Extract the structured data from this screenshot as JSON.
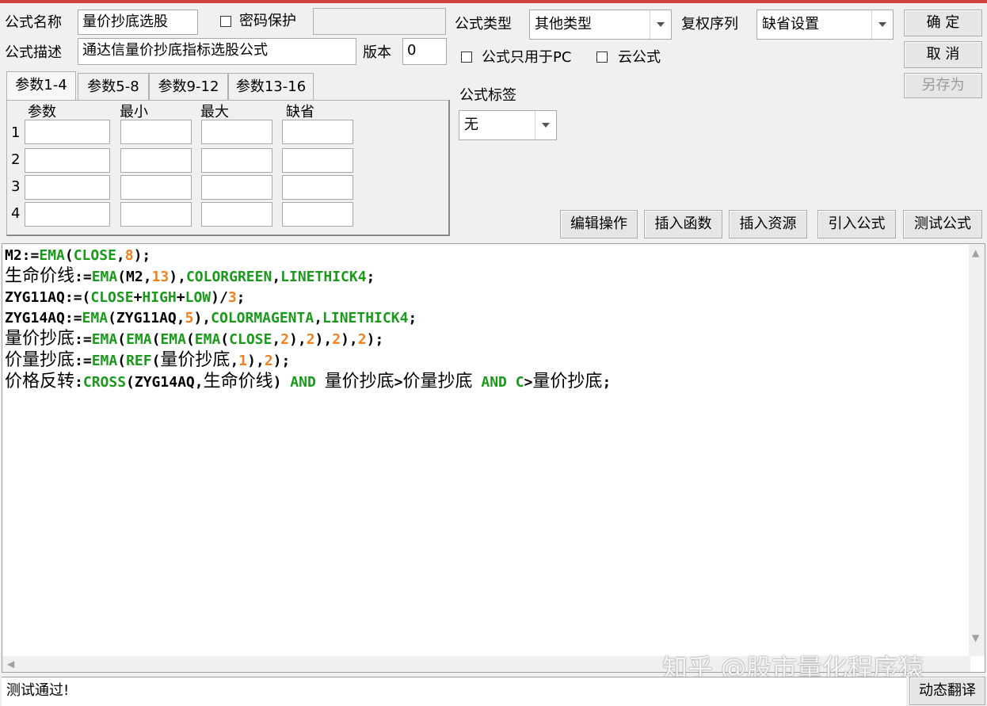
{
  "header": {
    "name_label": "公式名称",
    "name_value": "量价抄底选股",
    "password_label": "密码保护",
    "desc_label": "公式描述",
    "desc_value": "通达信量价抄底指标选股公式",
    "version_label": "版本",
    "version_value": "0",
    "type_label": "公式类型",
    "type_value": "其他类型",
    "rights_label": "复权序列",
    "rights_value": "缺省设置",
    "pc_only_label": "公式只用于PC",
    "cloud_label": "云公式",
    "tag_label": "公式标签",
    "tag_value": "无"
  },
  "buttons": {
    "ok": "确 定",
    "cancel": "取 消",
    "save_as": "另存为",
    "edit_ops": "编辑操作",
    "insert_func": "插入函数",
    "insert_res": "插入资源",
    "import_formula": "引入公式",
    "test_formula": "测试公式",
    "dynamic_translate": "动态翻译"
  },
  "params": {
    "tabs": [
      "参数1-4",
      "参数5-8",
      "参数9-12",
      "参数13-16"
    ],
    "columns": [
      "参数",
      "最小",
      "最大",
      "缺省"
    ],
    "rows": [
      "1",
      "2",
      "3",
      "4"
    ]
  },
  "code_lines": [
    [
      {
        "t": "M2:=",
        "c": "k"
      },
      {
        "t": "EMA",
        "c": "g"
      },
      {
        "t": "(",
        "c": "k"
      },
      {
        "t": "CLOSE",
        "c": "g"
      },
      {
        "t": ",",
        "c": "k"
      },
      {
        "t": "8",
        "c": "o"
      },
      {
        "t": ");",
        "c": "k"
      }
    ],
    [
      {
        "t": "生命价线",
        "c": "cn"
      },
      {
        "t": ":=",
        "c": "k"
      },
      {
        "t": "EMA",
        "c": "g"
      },
      {
        "t": "(M2,",
        "c": "k"
      },
      {
        "t": "13",
        "c": "o"
      },
      {
        "t": "),",
        "c": "k"
      },
      {
        "t": "COLORGREEN",
        "c": "g"
      },
      {
        "t": ",",
        "c": "k"
      },
      {
        "t": "LINETHICK4",
        "c": "g"
      },
      {
        "t": ";",
        "c": "k"
      }
    ],
    [
      {
        "t": "ZYG11AQ:=(",
        "c": "k"
      },
      {
        "t": "CLOSE",
        "c": "g"
      },
      {
        "t": "+",
        "c": "k"
      },
      {
        "t": "HIGH",
        "c": "g"
      },
      {
        "t": "+",
        "c": "k"
      },
      {
        "t": "LOW",
        "c": "g"
      },
      {
        "t": ")/",
        "c": "k"
      },
      {
        "t": "3",
        "c": "o"
      },
      {
        "t": ";",
        "c": "k"
      }
    ],
    [
      {
        "t": "ZYG14AQ:=",
        "c": "k"
      },
      {
        "t": "EMA",
        "c": "g"
      },
      {
        "t": "(ZYG11AQ,",
        "c": "k"
      },
      {
        "t": "5",
        "c": "o"
      },
      {
        "t": "),",
        "c": "k"
      },
      {
        "t": "COLORMAGENTA",
        "c": "g"
      },
      {
        "t": ",",
        "c": "k"
      },
      {
        "t": "LINETHICK4",
        "c": "g"
      },
      {
        "t": ";",
        "c": "k"
      }
    ],
    [
      {
        "t": "量价抄底",
        "c": "cn"
      },
      {
        "t": ":=",
        "c": "k"
      },
      {
        "t": "EMA",
        "c": "g"
      },
      {
        "t": "(",
        "c": "k"
      },
      {
        "t": "EMA",
        "c": "g"
      },
      {
        "t": "(",
        "c": "k"
      },
      {
        "t": "EMA",
        "c": "g"
      },
      {
        "t": "(",
        "c": "k"
      },
      {
        "t": "EMA",
        "c": "g"
      },
      {
        "t": "(",
        "c": "k"
      },
      {
        "t": "CLOSE",
        "c": "g"
      },
      {
        "t": ",",
        "c": "k"
      },
      {
        "t": "2",
        "c": "o"
      },
      {
        "t": "),",
        "c": "k"
      },
      {
        "t": "2",
        "c": "o"
      },
      {
        "t": "),",
        "c": "k"
      },
      {
        "t": "2",
        "c": "o"
      },
      {
        "t": "),",
        "c": "k"
      },
      {
        "t": "2",
        "c": "o"
      },
      {
        "t": ");",
        "c": "k"
      }
    ],
    [
      {
        "t": "价量抄底",
        "c": "cn"
      },
      {
        "t": ":=",
        "c": "k"
      },
      {
        "t": "EMA",
        "c": "g"
      },
      {
        "t": "(",
        "c": "k"
      },
      {
        "t": "REF",
        "c": "g"
      },
      {
        "t": "(",
        "c": "k"
      },
      {
        "t": "量价抄底",
        "c": "cn"
      },
      {
        "t": ",",
        "c": "k"
      },
      {
        "t": "1",
        "c": "o"
      },
      {
        "t": "),",
        "c": "k"
      },
      {
        "t": "2",
        "c": "o"
      },
      {
        "t": ");",
        "c": "k"
      }
    ],
    [
      {
        "t": "价格反转",
        "c": "cn"
      },
      {
        "t": ":",
        "c": "k"
      },
      {
        "t": "CROSS",
        "c": "g"
      },
      {
        "t": "(ZYG14AQ,",
        "c": "k"
      },
      {
        "t": "生命价线",
        "c": "cn"
      },
      {
        "t": ") ",
        "c": "k"
      },
      {
        "t": "AND",
        "c": "g"
      },
      {
        "t": " ",
        "c": "k"
      },
      {
        "t": "量价抄底",
        "c": "cn"
      },
      {
        "t": ">",
        "c": "k"
      },
      {
        "t": "价量抄底",
        "c": "cn"
      },
      {
        "t": " ",
        "c": "k"
      },
      {
        "t": "AND",
        "c": "g"
      },
      {
        "t": " ",
        "c": "k"
      },
      {
        "t": "C",
        "c": "g"
      },
      {
        "t": ">",
        "c": "k"
      },
      {
        "t": "量价抄底",
        "c": "cn"
      },
      {
        "t": ";",
        "c": "k"
      }
    ]
  ],
  "status_text": "测试通过!",
  "watermark": "知乎 @股市量化程序猿",
  "colors": {
    "keyword": "#1a9a1a",
    "number": "#f08020",
    "accent_line": "#d04040"
  }
}
